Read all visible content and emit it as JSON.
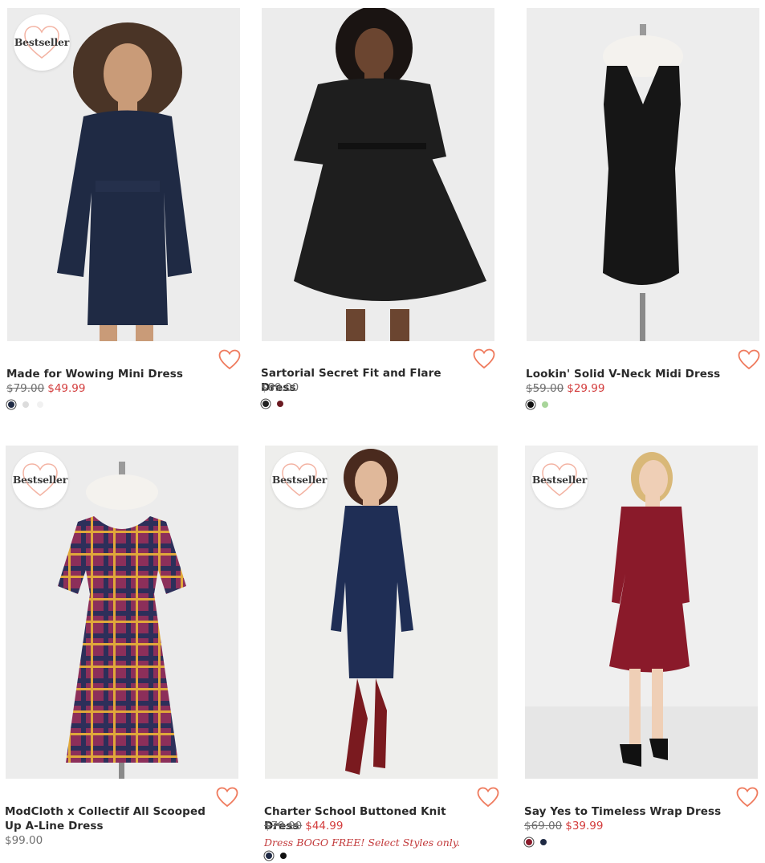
{
  "badge_label": "Bestseller",
  "colors": {
    "sale": "#d33c3c",
    "heart": "#ef7b5e",
    "promo": "#c2393a"
  },
  "products": [
    {
      "title": "Made for Wowing Mini Dress",
      "was": "$79.00",
      "now": "$49.99",
      "bestseller": true,
      "swatches": [
        "#1f2a44",
        "#dcdcdc",
        "#f3f3f3"
      ]
    },
    {
      "title": "Sartorial Secret Fit and Flare Dress",
      "price": "$89.00",
      "bestseller": false,
      "swatches": [
        "#222222",
        "#6b1a22"
      ]
    },
    {
      "title": "Lookin' Solid V-Neck Midi Dress",
      "was": "$59.00",
      "now": "$29.99",
      "bestseller": false,
      "swatches": [
        "#111111",
        "#a8d59a"
      ]
    },
    {
      "title": "ModCloth x Collectif All Scooped Up A-Line Dress",
      "price": "$99.00",
      "bestseller": true,
      "swatches": []
    },
    {
      "title": "Charter School Buttoned Knit Dress",
      "was": "$79.00",
      "now": "$44.99",
      "promo": "Dress BOGO FREE! Select Styles only.",
      "bestseller": true,
      "swatches": [
        "#1f2a44",
        "#111111"
      ]
    },
    {
      "title": "Say Yes to Timeless Wrap Dress",
      "was": "$69.00",
      "now": "$39.99",
      "bestseller": true,
      "swatches": [
        "#8a1a2a",
        "#1f2a44"
      ]
    }
  ]
}
